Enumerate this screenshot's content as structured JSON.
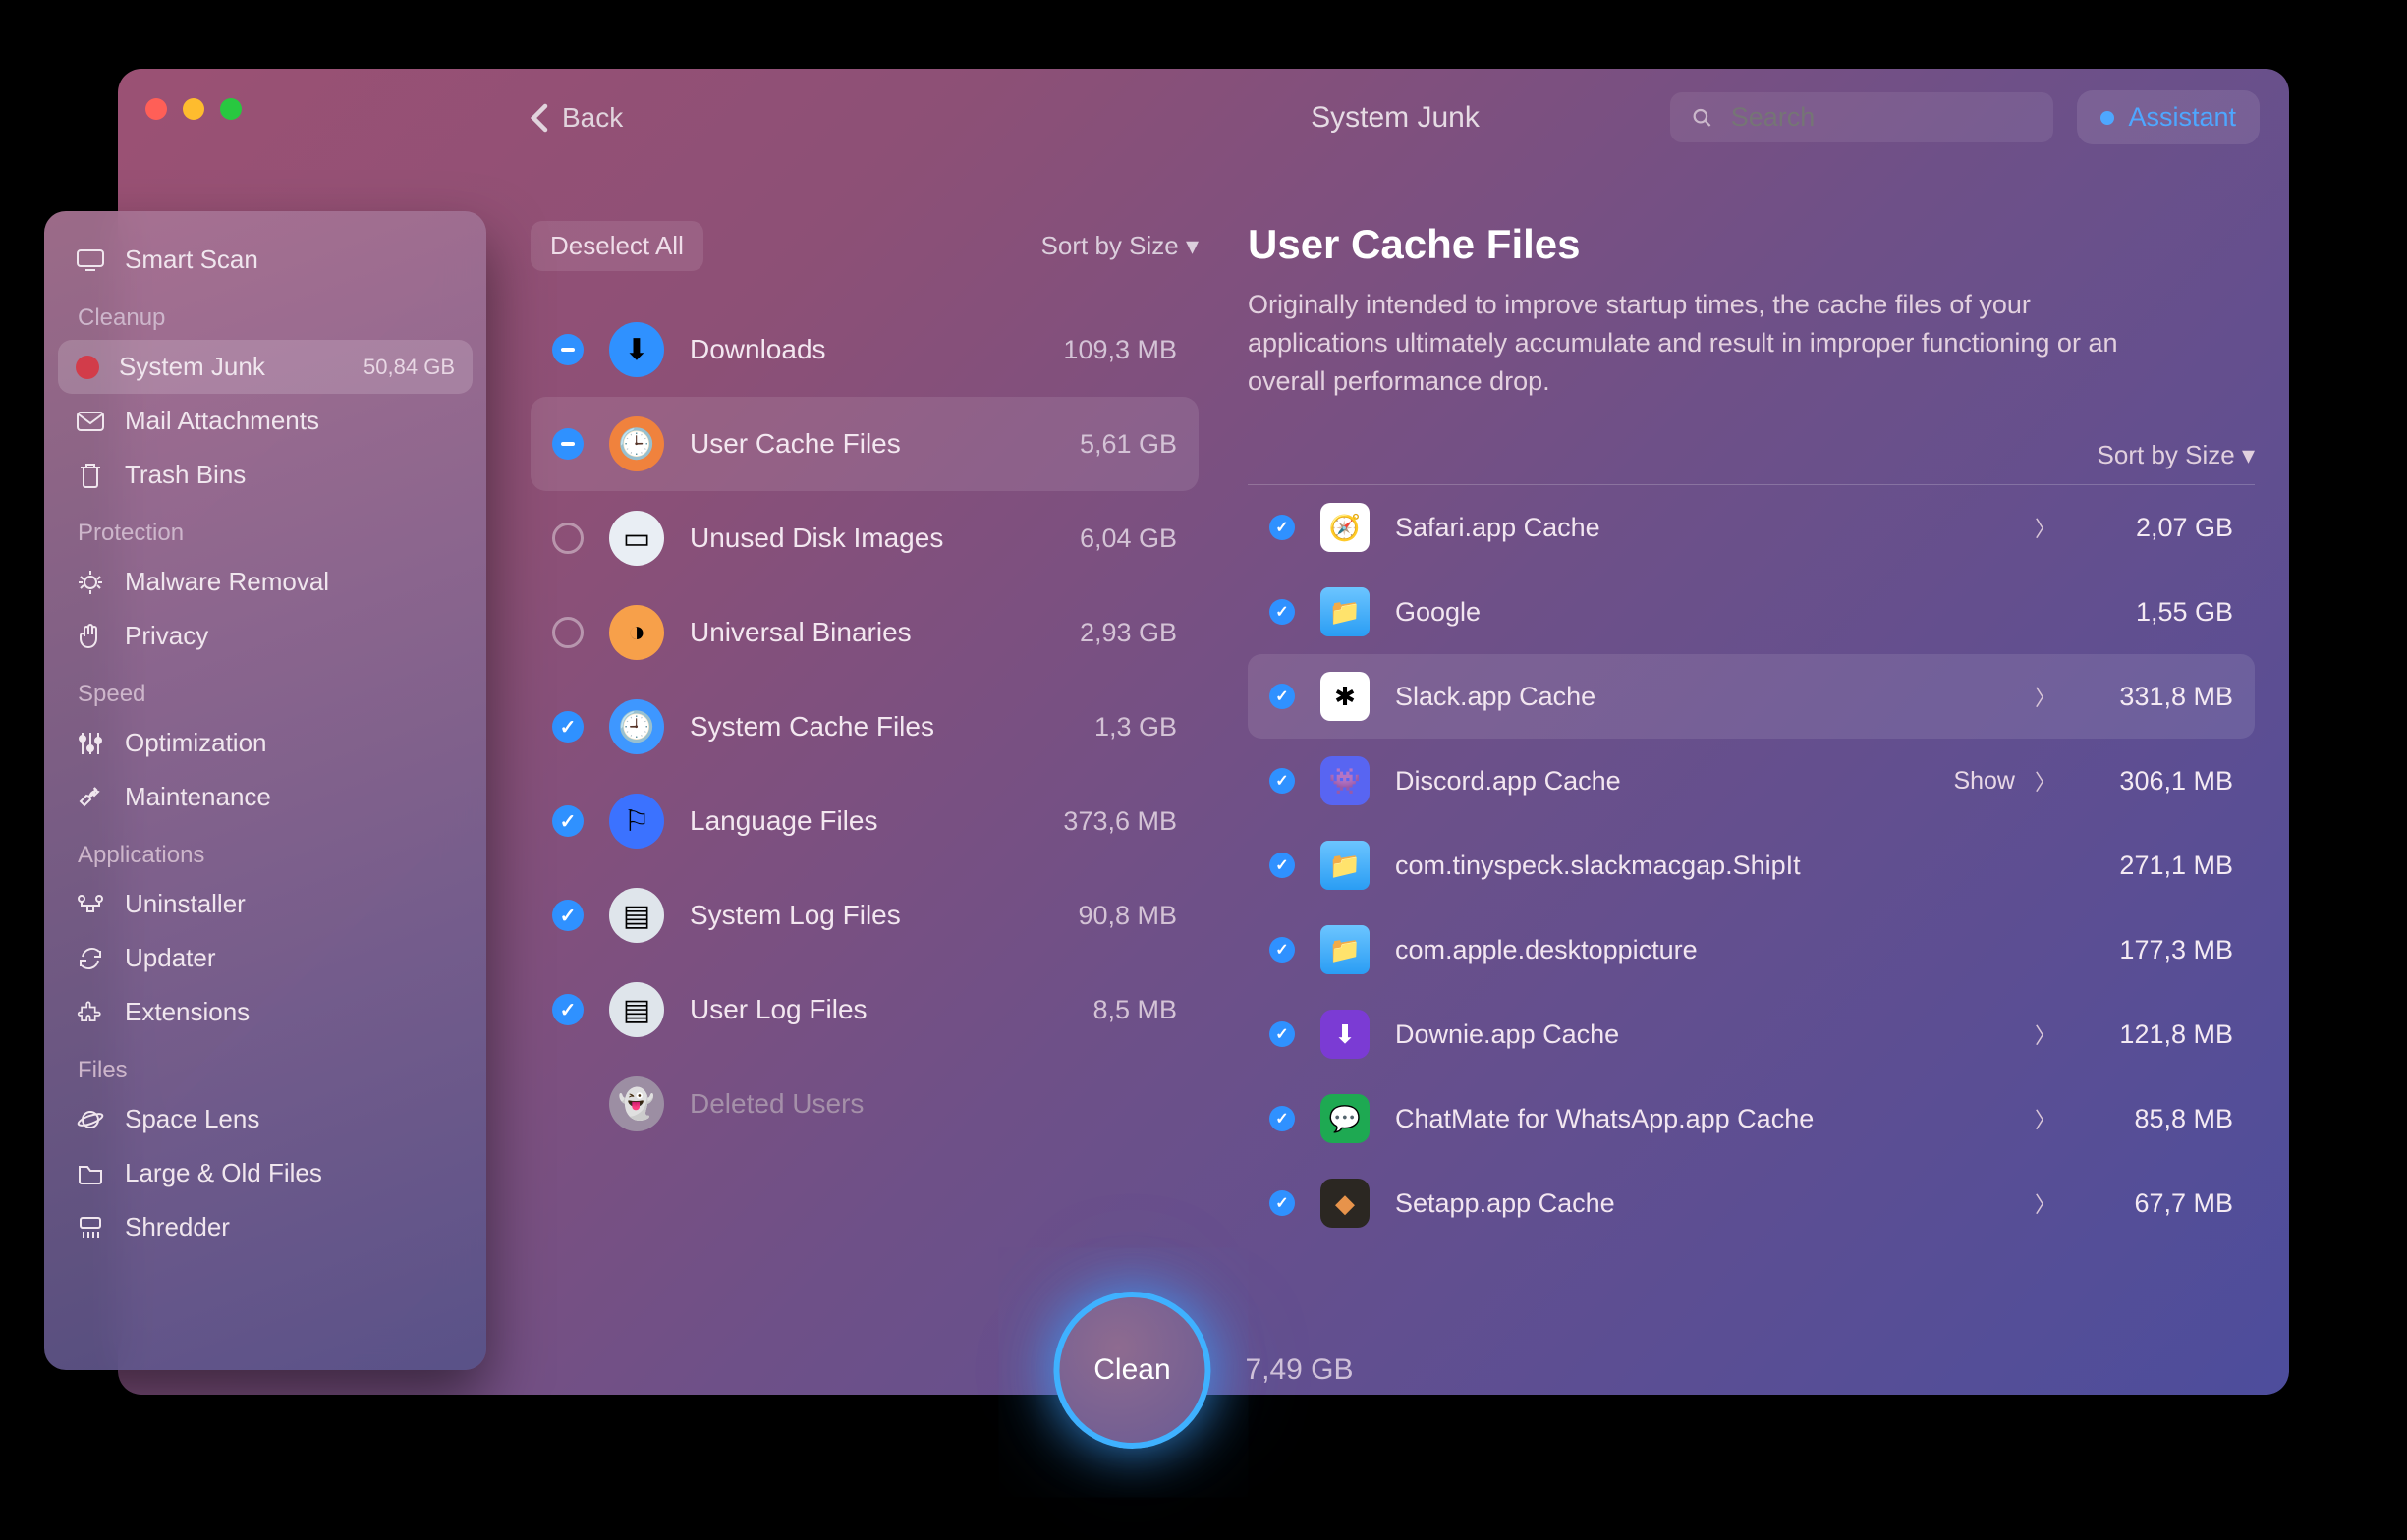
{
  "header": {
    "back": "Back",
    "title": "System Junk",
    "search_placeholder": "Search",
    "assistant": "Assistant"
  },
  "sidebar": {
    "smart_scan": "Smart Scan",
    "sections": {
      "cleanup": {
        "title": "Cleanup",
        "system_junk": "System Junk",
        "system_junk_size": "50,84 GB",
        "mail": "Mail Attachments",
        "trash": "Trash Bins"
      },
      "protection": {
        "title": "Protection",
        "malware": "Malware Removal",
        "privacy": "Privacy"
      },
      "speed": {
        "title": "Speed",
        "optimization": "Optimization",
        "maintenance": "Maintenance"
      },
      "applications": {
        "title": "Applications",
        "uninstaller": "Uninstaller",
        "updater": "Updater",
        "extensions": "Extensions"
      },
      "files": {
        "title": "Files",
        "space_lens": "Space Lens",
        "large_old": "Large & Old Files",
        "shredder": "Shredder"
      }
    }
  },
  "mid": {
    "deselect": "Deselect All",
    "sort": "Sort by Size ▾",
    "items": [
      {
        "label": "Downloads",
        "size": "109,3 MB",
        "state": "dash",
        "bg": "#2f91ff",
        "glyph": "⬇"
      },
      {
        "label": "User Cache Files",
        "size": "5,61 GB",
        "state": "dash",
        "bg": "#f0823d",
        "glyph": "🕒",
        "selected": true
      },
      {
        "label": "Unused Disk Images",
        "size": "6,04 GB",
        "state": "off",
        "bg": "#e9eef4",
        "glyph": "▭"
      },
      {
        "label": "Universal Binaries",
        "size": "2,93 GB",
        "state": "off",
        "bg": "#f7a04a",
        "glyph": "◑"
      },
      {
        "label": "System Cache Files",
        "size": "1,3 GB",
        "state": "on",
        "bg": "#3e97ff",
        "glyph": "🕘"
      },
      {
        "label": "Language Files",
        "size": "373,6 MB",
        "state": "on",
        "bg": "#3b72ff",
        "glyph": "⚐"
      },
      {
        "label": "System Log Files",
        "size": "90,8 MB",
        "state": "on",
        "bg": "#dfe5eb",
        "glyph": "▤"
      },
      {
        "label": "User Log Files",
        "size": "8,5 MB",
        "state": "on",
        "bg": "#dfe5eb",
        "glyph": "▤"
      },
      {
        "label": "Deleted Users",
        "size": "",
        "state": "none",
        "bg": "#9c8ea3",
        "glyph": "👻",
        "disabled": true
      }
    ]
  },
  "detail": {
    "title": "User Cache Files",
    "desc": "Originally intended to improve startup times, the cache files of your applications ultimately accumulate and result in improper functioning or an overall performance drop.",
    "sort": "Sort by Size ▾",
    "show": "Show",
    "items": [
      {
        "label": "Safari.app Cache",
        "size": "2,07 GB",
        "chev": true,
        "cls": "safari",
        "glyph": "🧭"
      },
      {
        "label": "Google",
        "size": "1,55 GB",
        "chev": false,
        "cls": "folder-blue",
        "glyph": "📁"
      },
      {
        "label": "Slack.app Cache",
        "size": "331,8 MB",
        "chev": true,
        "cls": "slack",
        "glyph": "✱",
        "hl": true
      },
      {
        "label": "Discord.app Cache",
        "size": "306,1 MB",
        "chev": true,
        "cls": "discord",
        "glyph": "👾",
        "show": true
      },
      {
        "label": "com.tinyspeck.slackmacgap.ShipIt",
        "size": "271,1 MB",
        "chev": false,
        "cls": "folder-blue",
        "glyph": "📁"
      },
      {
        "label": "com.apple.desktoppicture",
        "size": "177,3 MB",
        "chev": false,
        "cls": "folder-blue",
        "glyph": "📁"
      },
      {
        "label": "Downie.app Cache",
        "size": "121,8 MB",
        "chev": true,
        "cls": "downie",
        "glyph": "⬇"
      },
      {
        "label": "ChatMate for WhatsApp.app Cache",
        "size": "85,8 MB",
        "chev": true,
        "cls": "chatmate",
        "glyph": "💬"
      },
      {
        "label": "Setapp.app Cache",
        "size": "67,7 MB",
        "chev": true,
        "cls": "setapp",
        "glyph": "◆"
      }
    ]
  },
  "clean": {
    "label": "Clean",
    "size": "7,49 GB"
  }
}
